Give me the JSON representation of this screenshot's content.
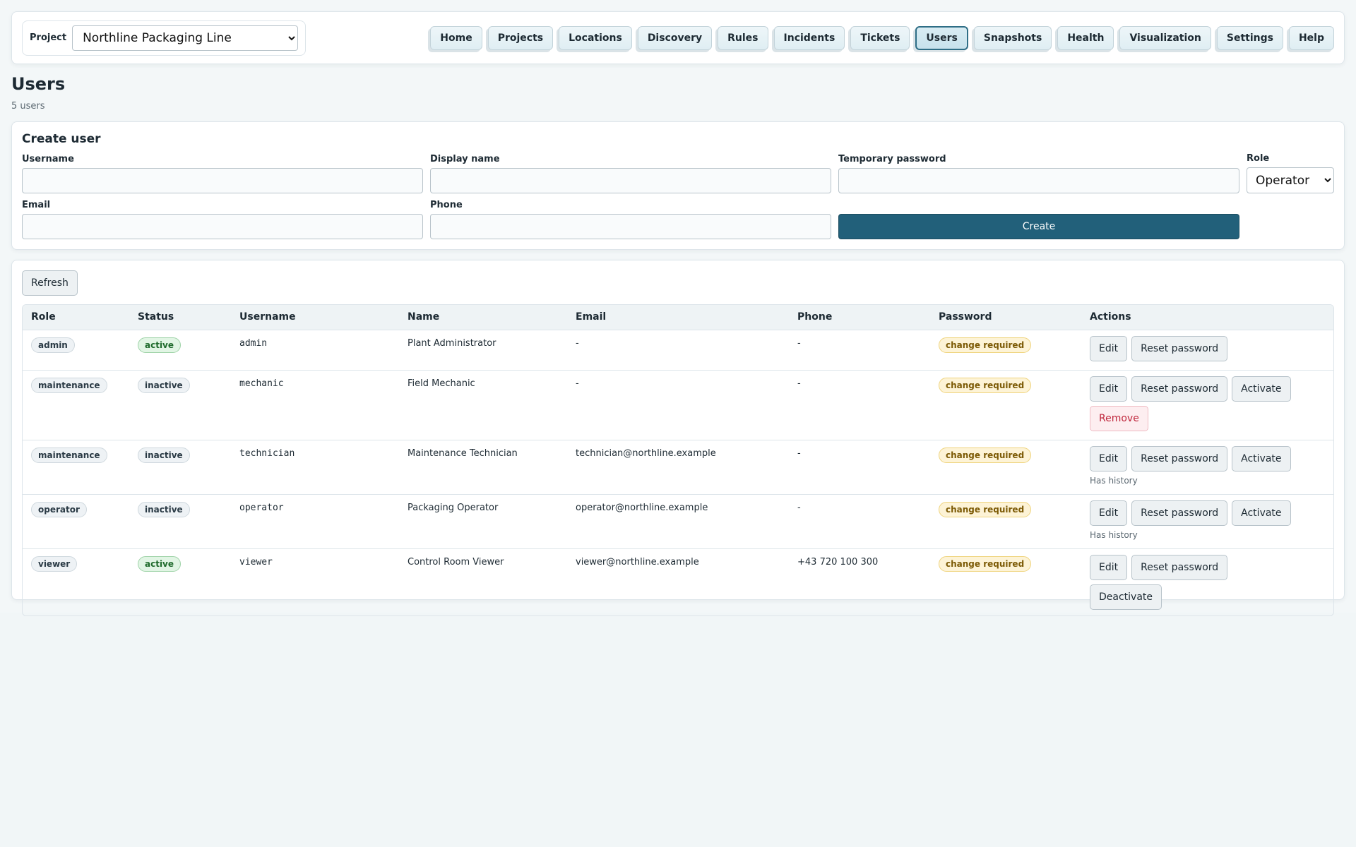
{
  "header": {
    "project_label": "Project",
    "project_selected": "Northline Packaging Line",
    "nav": [
      "Home",
      "Projects",
      "Locations",
      "Discovery",
      "Rules",
      "Incidents",
      "Tickets",
      "Users",
      "Snapshots",
      "Health",
      "Visualization",
      "Settings",
      "Help"
    ],
    "active_nav": "Users"
  },
  "page": {
    "title": "Users",
    "subtitle": "5 users"
  },
  "create": {
    "title": "Create user",
    "username_label": "Username",
    "display_name_label": "Display name",
    "temp_password_label": "Temporary password",
    "role_label": "Role",
    "role_selected": "Operator",
    "email_label": "Email",
    "phone_label": "Phone",
    "create_button": "Create"
  },
  "list": {
    "refresh_button": "Refresh",
    "columns": [
      "Role",
      "Status",
      "Username",
      "Name",
      "Email",
      "Phone",
      "Password",
      "Actions"
    ],
    "rows": [
      {
        "role": "admin",
        "status": "active",
        "username": "admin",
        "name": "Plant Administrator",
        "email": "-",
        "phone": "-",
        "password": "change required",
        "actions": [
          "Edit",
          "Reset password"
        ],
        "danger_action": "",
        "note": ""
      },
      {
        "role": "maintenance",
        "status": "inactive",
        "username": "mechanic",
        "name": "Field Mechanic",
        "email": "-",
        "phone": "-",
        "password": "change required",
        "actions": [
          "Edit",
          "Reset password",
          "Activate"
        ],
        "danger_action": "Remove",
        "note": ""
      },
      {
        "role": "maintenance",
        "status": "inactive",
        "username": "technician",
        "name": "Maintenance Technician",
        "email": "technician@northline.example",
        "phone": "-",
        "password": "change required",
        "actions": [
          "Edit",
          "Reset password",
          "Activate"
        ],
        "danger_action": "",
        "note": "Has history"
      },
      {
        "role": "operator",
        "status": "inactive",
        "username": "operator",
        "name": "Packaging Operator",
        "email": "operator@northline.example",
        "phone": "-",
        "password": "change required",
        "actions": [
          "Edit",
          "Reset password",
          "Activate"
        ],
        "danger_action": "",
        "note": "Has history"
      },
      {
        "role": "viewer",
        "status": "active",
        "username": "viewer",
        "name": "Control Room Viewer",
        "email": "viewer@northline.example",
        "phone": "+43 720 100 300",
        "password": "change required",
        "actions": [
          "Edit",
          "Reset password",
          "Deactivate"
        ],
        "danger_action": "",
        "note": ""
      }
    ]
  },
  "colors": {
    "accent": "#22607a",
    "active_green": "#1f6b2c",
    "warn_amber": "#7c5a05",
    "danger_red": "#c0283d",
    "background": "#f3f7f8"
  }
}
